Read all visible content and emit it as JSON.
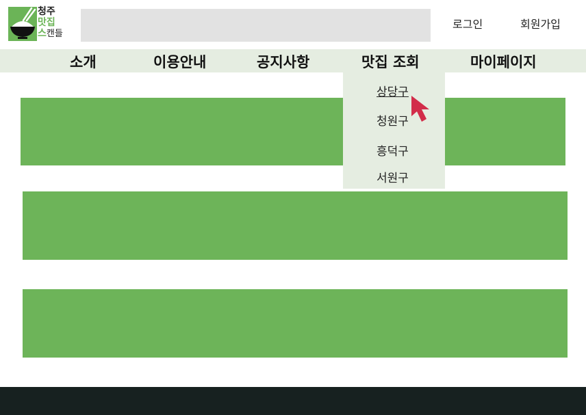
{
  "logo": {
    "line1": "청주",
    "line2": "맛집",
    "line3_accent": "스",
    "line3_rest": "캔들"
  },
  "search": {
    "value": "",
    "placeholder": ""
  },
  "header": {
    "login_label": "로그인",
    "signup_label": "회원가입"
  },
  "nav": {
    "items": [
      {
        "label": "소개"
      },
      {
        "label": "이용안내"
      },
      {
        "label": "공지사항"
      },
      {
        "label": "맛집 조회"
      },
      {
        "label": "마이페이지"
      }
    ]
  },
  "dropdown": {
    "items": [
      {
        "label": "상당구"
      },
      {
        "label": "청원구"
      },
      {
        "label": "흥덕구"
      },
      {
        "label": "서원구"
      }
    ]
  },
  "colors": {
    "brand_green": "#6bb457",
    "nav_background": "#e5ede1",
    "search_background": "#e2e2e2",
    "footer_background": "#172120",
    "cursor": "#d22d4a"
  },
  "icons": {
    "logo": "rice-bowl-chopsticks-icon",
    "cursor": "mouse-pointer-icon"
  }
}
